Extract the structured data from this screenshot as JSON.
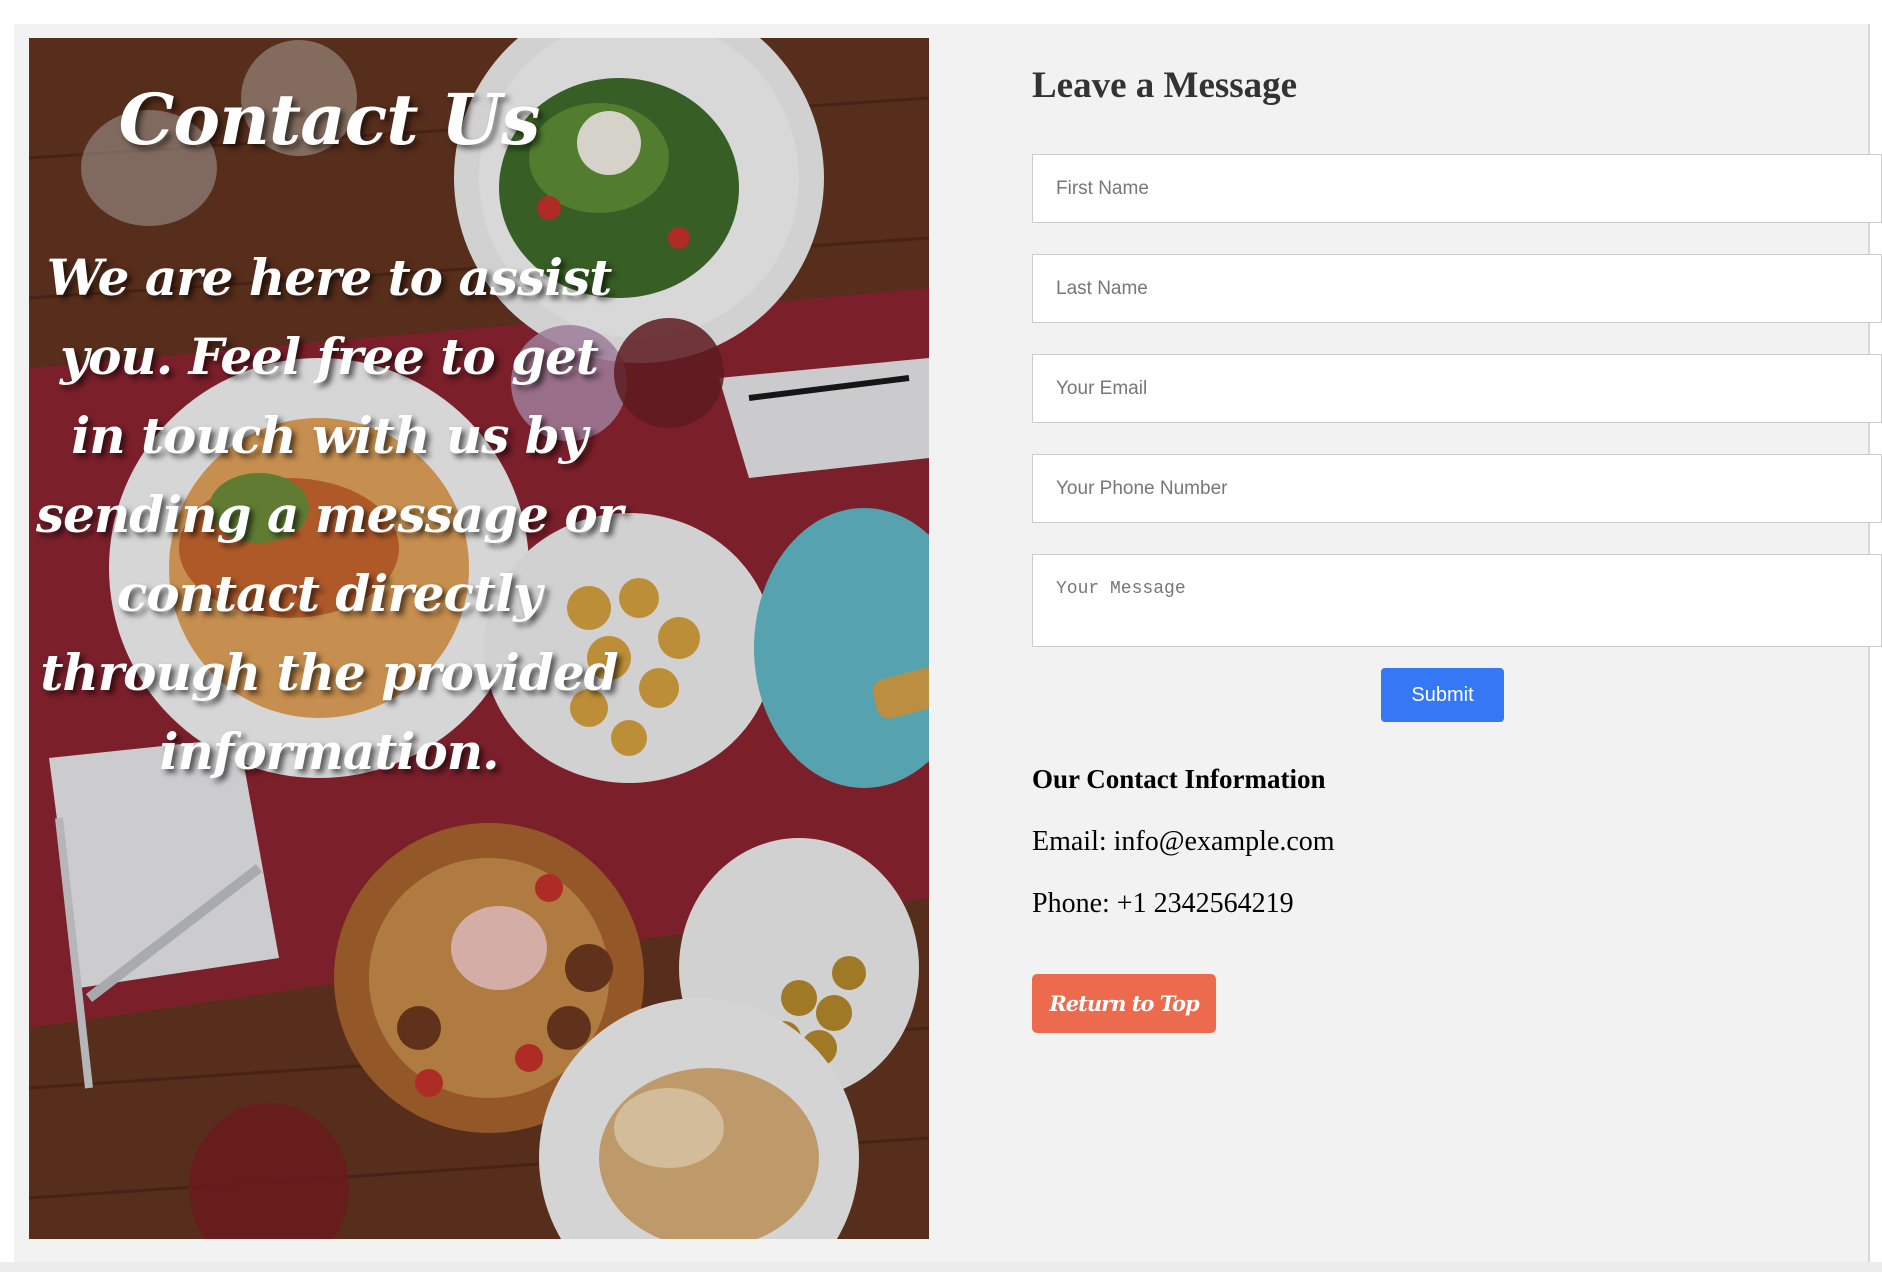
{
  "hero": {
    "title": "Contact Us",
    "text": "We are here to assist you. Feel free to get in touch with us by sending a message or contact directly through the provided information.",
    "image_subject": "restaurant table with plates of food"
  },
  "form": {
    "heading": "Leave a Message",
    "first_name_placeholder": "First Name",
    "last_name_placeholder": "Last Name",
    "email_placeholder": "Your Email",
    "phone_placeholder": "Your Phone Number",
    "message_placeholder": "Your Message",
    "submit_label": "Submit"
  },
  "contact_info": {
    "heading": "Our Contact Information",
    "email_line": "Email: info@example.com",
    "phone_line": "Phone: +1 2342564219"
  },
  "return_to_top_label": "Return to Top",
  "colors": {
    "page_background": "#f2f2f2",
    "submit_button": "#3478f6",
    "return_button": "#ec6b4e",
    "heading_text": "#333333"
  }
}
